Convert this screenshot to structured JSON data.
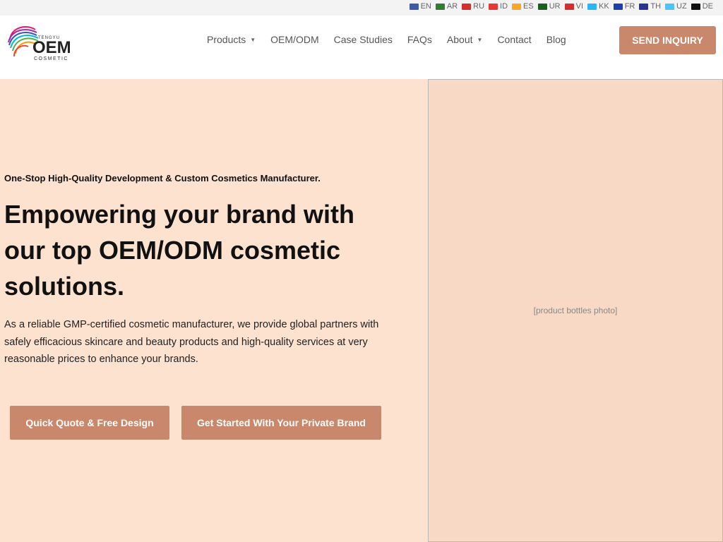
{
  "languages": [
    {
      "code": "EN",
      "color": "#3c5aa6"
    },
    {
      "code": "AR",
      "color": "#2e7d32"
    },
    {
      "code": "RU",
      "color": "#d32f2f"
    },
    {
      "code": "ID",
      "color": "#e53935"
    },
    {
      "code": "ES",
      "color": "#f9a825"
    },
    {
      "code": "UR",
      "color": "#1b5e20"
    },
    {
      "code": "VI",
      "color": "#d32f2f"
    },
    {
      "code": "KK",
      "color": "#29b6f6"
    },
    {
      "code": "FR",
      "color": "#1e40af"
    },
    {
      "code": "TH",
      "color": "#283593"
    },
    {
      "code": "UZ",
      "color": "#4fc3f7"
    },
    {
      "code": "DE",
      "color": "#111111"
    }
  ],
  "logo": {
    "brand_small": "TENGYU",
    "brand": "OEM",
    "subtitle": "COSMETIC"
  },
  "nav": {
    "products": "Products",
    "oem_odm": "OEM/ODM",
    "case_studies": "Case Studies",
    "faqs": "FAQs",
    "about": "About",
    "contact": "Contact",
    "blog": "Blog"
  },
  "header": {
    "send_inquiry": "SEND INQUIRY"
  },
  "hero": {
    "tagline": "One-Stop High-Quality Development & Custom Cosmetics Manufacturer.",
    "headline": "Empowering your brand with our top OEM/ODM cosmetic solutions.",
    "description": "As a reliable GMP-certified cosmetic manufacturer, we provide global partners with safely efficacious skincare and beauty products and high-quality services at very reasonable prices to enhance your brands.",
    "btn_quote": "Quick Quote & Free Design",
    "btn_start": "Get Started With Your Private Brand",
    "photo_label": "[product bottles photo]"
  },
  "colors": {
    "accent": "#c9876b",
    "hero_bg": "#fde2d0"
  }
}
